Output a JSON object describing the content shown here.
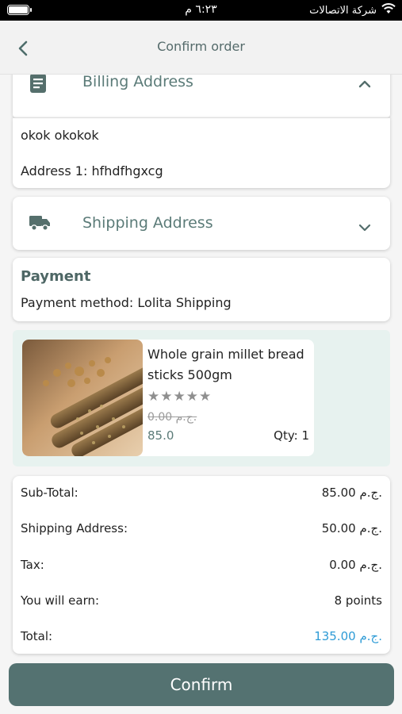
{
  "status_bar": {
    "time": "٦:٢٣ م",
    "carrier": "شركة الاتصالات"
  },
  "header": {
    "title": "Confirm order"
  },
  "billing": {
    "title": "Billing Address",
    "name": "okok okokok",
    "address_label": "Address 1:",
    "address_value": "hfhdfhgxcg"
  },
  "shipping": {
    "title": "Shipping Address"
  },
  "payment": {
    "title": "Payment",
    "method_text": "Payment method: Lolita Shipping"
  },
  "product": {
    "name": "Whole grain millet bread sticks 500gm",
    "stars": "★★★★★",
    "old_price": "0.00 ج.م.",
    "price": "85.0",
    "qty": "Qty: 1"
  },
  "totals": [
    {
      "label": "Sub-Total:",
      "value": "85.00 ج.م."
    },
    {
      "label": "Shipping Address:",
      "value": "50.00 ج.م."
    },
    {
      "label": "Tax:",
      "value": "0.00 ج.م."
    },
    {
      "label": "You will earn:",
      "value": "8 points"
    },
    {
      "label": "Total:",
      "value": "135.00 ج.م."
    }
  ],
  "confirm_label": "Confirm",
  "colors": {
    "accent": "#547271",
    "label": "#5b7b78",
    "total": "#2e9bd6",
    "product_bg": "#e7f2ef"
  }
}
